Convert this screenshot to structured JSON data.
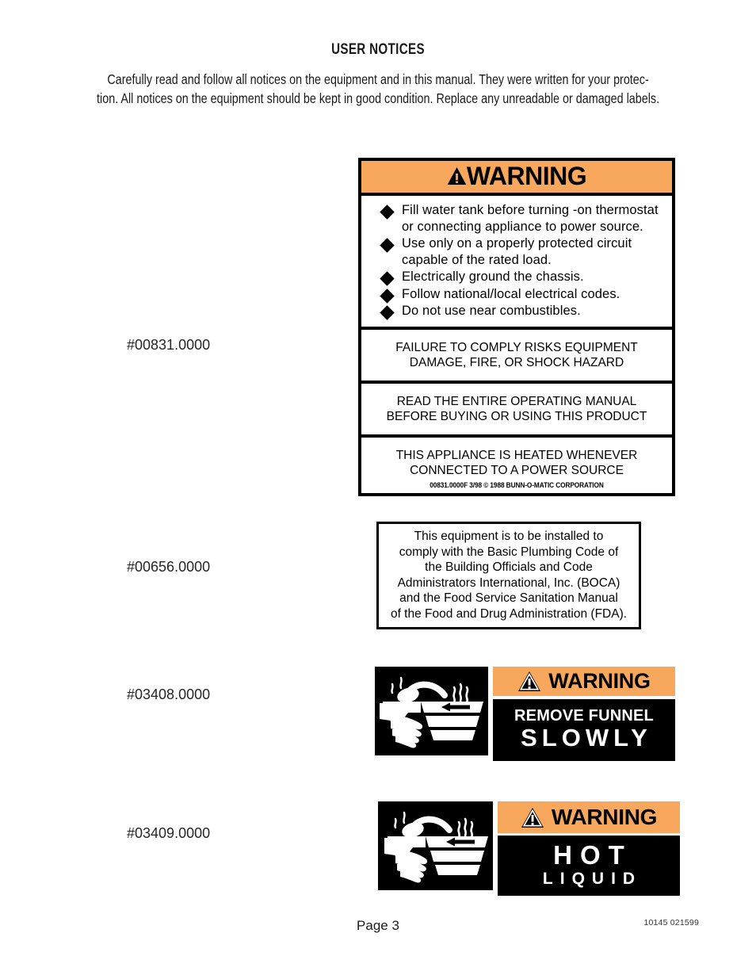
{
  "document": {
    "title": "USER NOTICES",
    "intro_line_1": "Carefully read and follow all notices on the equipment and in this manual.  They were written for your protec-",
    "intro_line_2": "tion.  All notices on the equipment should be kept in good condition.  Replace any unreadable or damaged labels."
  },
  "part_numbers": [
    "#00831.0000",
    "#00656.0000",
    "#03408.0000",
    "#03409.0000"
  ],
  "labels": {
    "warning_main": {
      "banner_word": "WARNING",
      "banner_icon": "warning-triangle-icon",
      "bullets": [
        "Fill water tank before turning -on thermostat or connecting appliance to power source.",
        "Use only on a properly protected circuit capable of the rated load.",
        "Electrically ground the chassis.",
        "Follow national/local electrical codes.",
        "Do not use near combustibles."
      ],
      "notice_1_line_1": "FAILURE TO COMPLY RISKS EQUIPMENT",
      "notice_1_line_2": "DAMAGE, FIRE, OR SHOCK HAZARD",
      "notice_2_line_1": "READ THE ENTIRE OPERATING MANUAL",
      "notice_2_line_2": "BEFORE BUYING OR USING THIS PRODUCT",
      "notice_3_line_1": "THIS APPLIANCE IS HEATED WHENEVER",
      "notice_3_line_2": "CONNECTED TO A POWER SOURCE",
      "copyright": "00831.0000F  3/98  © 1988  BUNN-O-MATIC CORPORATION"
    },
    "plumbing_code": {
      "line_1": "This equipment is to be installed to",
      "line_2": "comply with the Basic Plumbing Code of",
      "line_3": "the Building Officials and Code",
      "line_4": "Administrators International, Inc. (BOCA)",
      "line_5": "and the Food Service Sanitation Manual",
      "line_6": "of the Food and Drug Administration (FDA)."
    },
    "remove_funnel": {
      "pictogram": "hand-steam-funnel-icon",
      "banner_word": "WARNING",
      "banner_icon": "warning-triangle-icon",
      "line_1": "REMOVE FUNNEL",
      "line_2": "SLOWLY"
    },
    "hot_liquid": {
      "pictogram": "hand-steam-funnel-icon",
      "banner_word": "WARNING",
      "banner_icon": "warning-triangle-icon",
      "line_1": "HOT",
      "line_2": "LIQUID"
    }
  },
  "footer": {
    "page": "Page 3",
    "code": "10145  021599"
  },
  "colors": {
    "warning_orange": "#f7a85c",
    "black": "#000000",
    "white": "#ffffff"
  }
}
